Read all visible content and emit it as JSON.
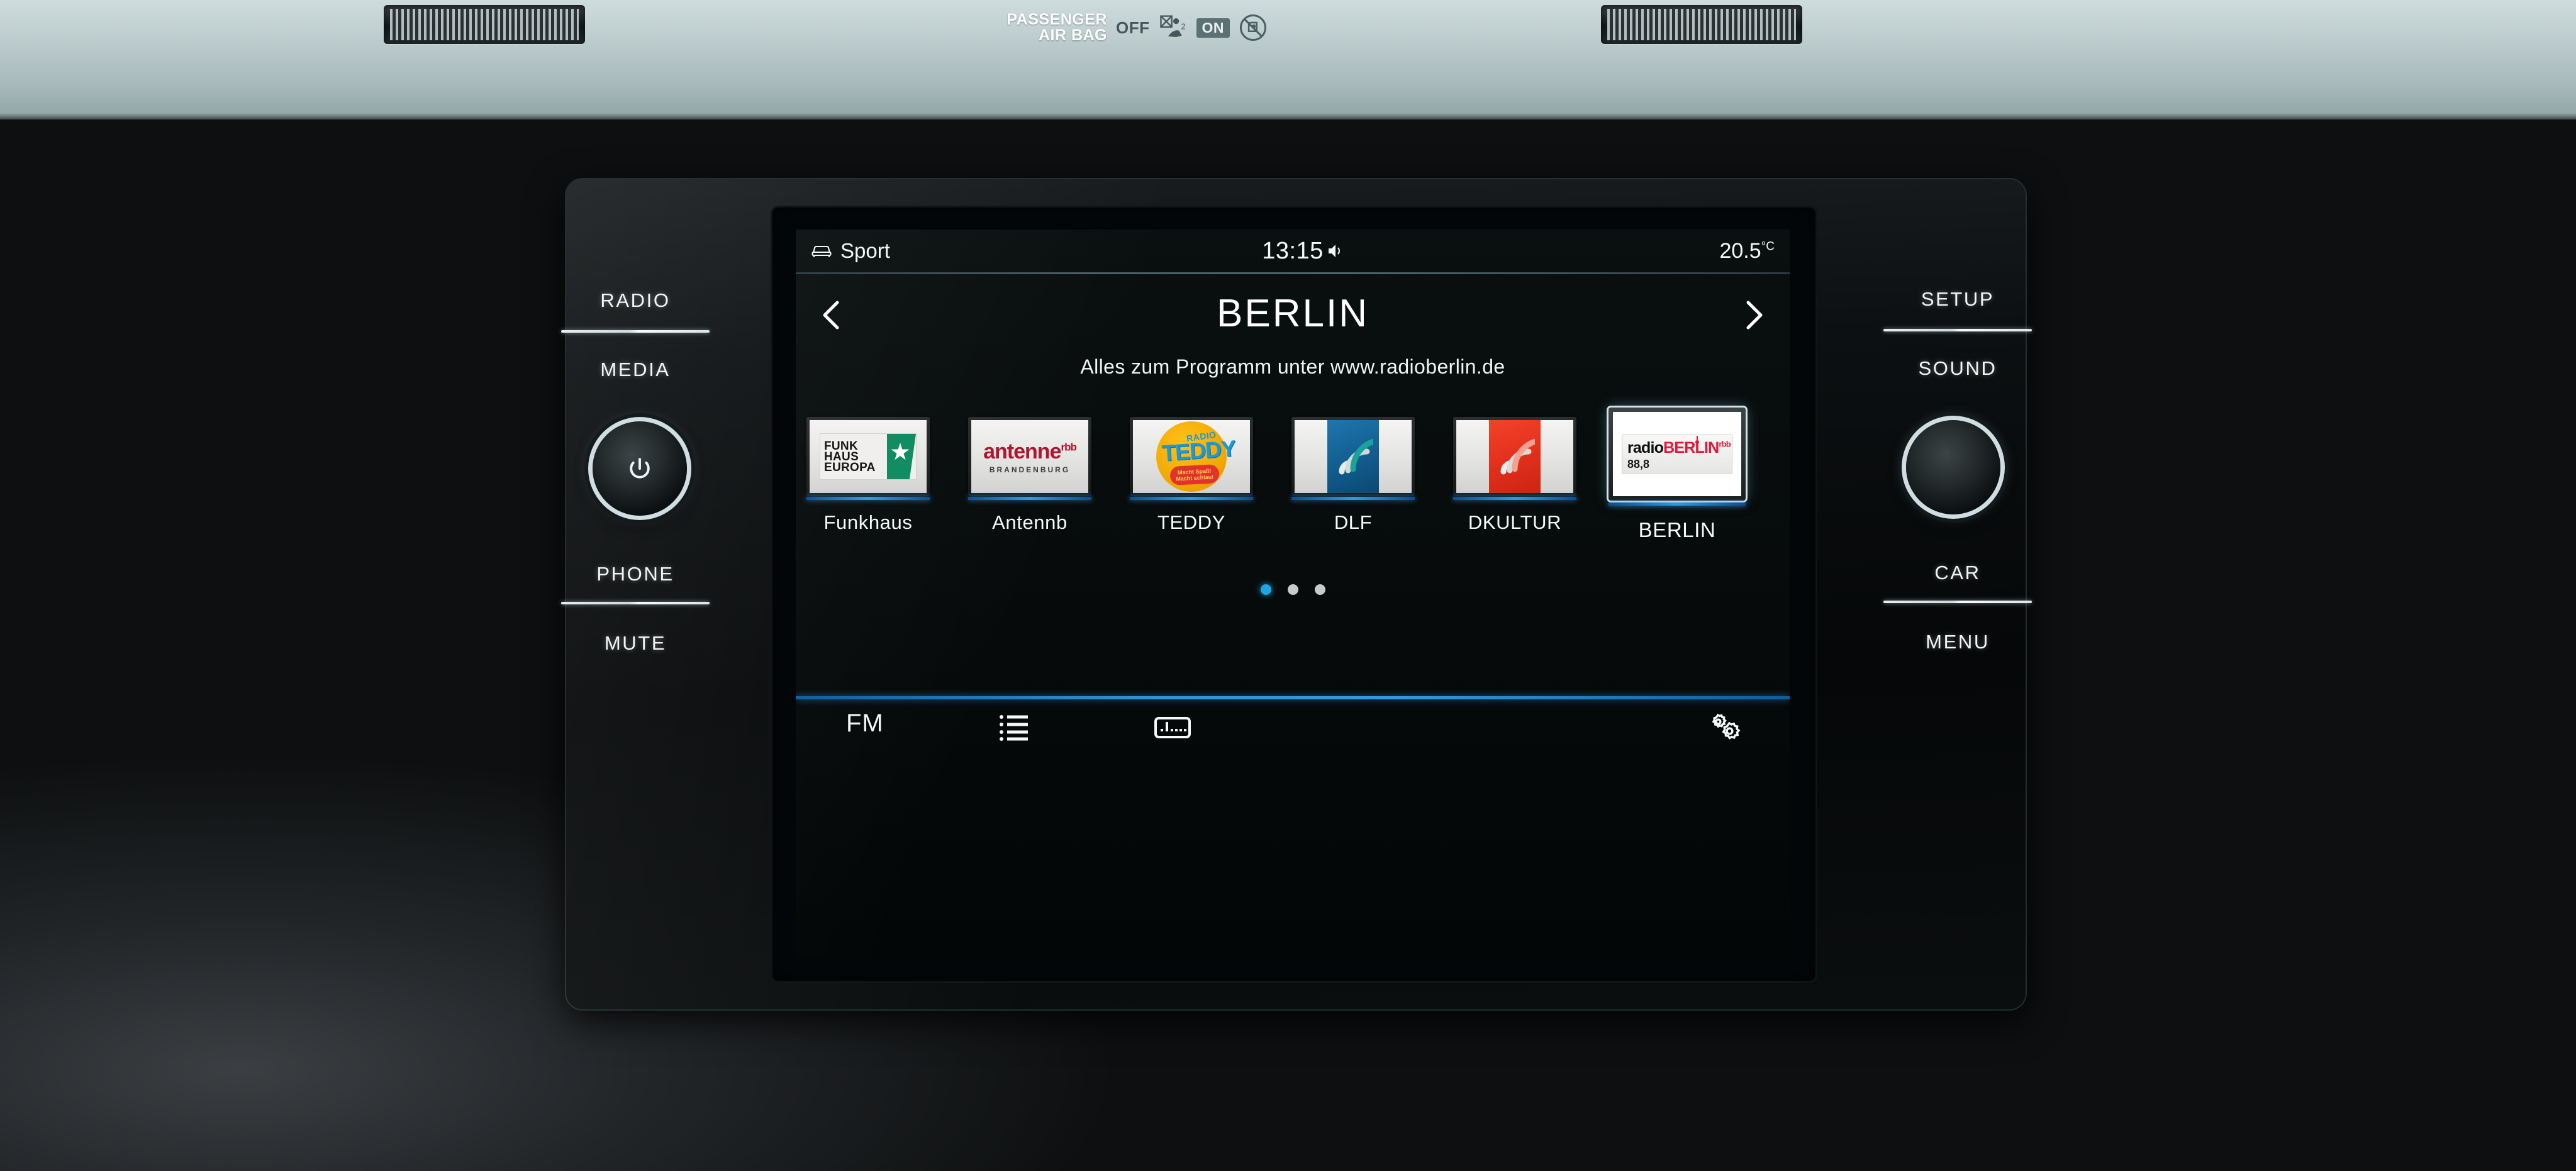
{
  "dashboard": {
    "airbag": {
      "label": "PASSENGER\nAIR BAG",
      "label_line1": "PASSENGER",
      "label_line2": "AIR BAG",
      "off_label": "OFF",
      "on_label": "ON"
    },
    "left_controls": [
      {
        "label": "RADIO"
      },
      {
        "label": "MEDIA"
      },
      {
        "label": "PHONE"
      },
      {
        "label": "MUTE"
      }
    ],
    "right_controls": [
      {
        "label": "SETUP"
      },
      {
        "label": "SOUND"
      },
      {
        "label": "CAR"
      },
      {
        "label": "MENU"
      }
    ],
    "left_knob": "power-knob",
    "right_knob": "tune-knob"
  },
  "screen": {
    "status": {
      "drive_mode": "Sport",
      "clock": "13:15",
      "temperature": "20.5",
      "temperature_unit": "°C",
      "speaker_icon": "speaker-icon",
      "car_icon": "car-front-icon"
    },
    "header": {
      "station_name": "BERLIN",
      "prev_icon": "chevron-left-icon",
      "next_icon": "chevron-right-icon"
    },
    "radio_text": "Alles zum Programm unter www.radioberlin.de",
    "presets": [
      {
        "label": "Funkhaus",
        "logo": "funkhaus-europa-logo",
        "logo_lines": [
          "FUNK",
          "HAUS",
          "EUROPA"
        ],
        "selected": false,
        "colors": {
          "green": "#0e8a5f"
        }
      },
      {
        "label": "Antennb",
        "logo": "antenne-brandenburg-logo",
        "logo_name": "antenne",
        "logo_sup": "rbb",
        "logo_sub": "BRANDENBURG",
        "selected": false,
        "colors": {
          "red": "#ac1530"
        }
      },
      {
        "label": "TEDDY",
        "logo": "radio-teddy-logo",
        "logo_radio": "RADIO",
        "logo_name": "TEDDY",
        "logo_slogan_1": "Macht Spaß!",
        "logo_slogan_2": "Macht schlau!",
        "selected": false,
        "colors": {
          "yellow": "#f0a400",
          "blue": "#1a9ad6",
          "red": "#e3322c"
        }
      },
      {
        "label": "DLF",
        "logo": "deutschlandfunk-wave-logo",
        "selected": false,
        "colors": {
          "blue": "#135f92"
        }
      },
      {
        "label": "DKULTUR",
        "logo": "deutschlandfunk-kultur-wave-logo",
        "selected": false,
        "colors": {
          "red": "#e4301d"
        }
      },
      {
        "label": "BERLIN",
        "logo": "radio-berlin-rbb-logo",
        "logo_prefix": "radio",
        "logo_name": "BERLIN",
        "logo_sup": "rbb",
        "logo_freq": "88,8",
        "selected": true,
        "colors": {
          "red": "#e2173a"
        }
      }
    ],
    "pagination": {
      "pages": 3,
      "active": 1
    },
    "bottom_bar": {
      "band_label": "FM",
      "list_icon": "list-icon",
      "tuner_icon": "manual-tuning-icon",
      "settings_icon": "settings-gears-icon"
    },
    "accent_color": "#2f9ae6"
  }
}
